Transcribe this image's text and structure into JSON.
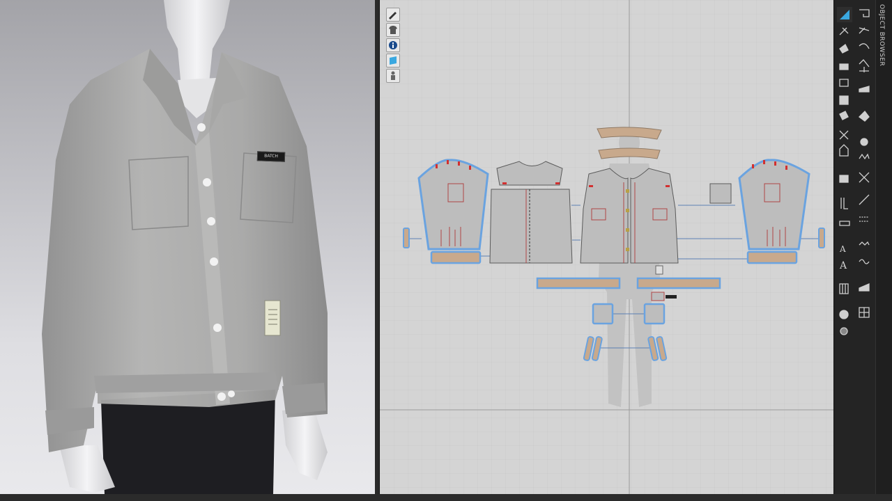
{
  "app": {
    "panels": {
      "object_browser_label": "OBJECT BROWSER"
    },
    "garment": {
      "name_tag_text": "BATCH"
    },
    "left_tools": [
      {
        "icon": "pencil-icon"
      },
      {
        "icon": "shirt-icon"
      },
      {
        "icon": "info-icon"
      },
      {
        "icon": "fabric-icon"
      },
      {
        "icon": "avatar-icon"
      }
    ],
    "right_tools_col1": [
      {
        "icon": "select-pattern-icon",
        "active": true
      },
      {
        "icon": "edit-pattern-icon"
      },
      {
        "icon": "transform-icon"
      },
      {
        "icon": "polygon-icon"
      },
      {
        "icon": "rectangle-icon"
      },
      {
        "icon": "internal-shape-icon"
      },
      {
        "icon": "fold-icon"
      },
      {
        "icon": "cut-icon"
      },
      {
        "icon": "sewing-icon"
      },
      {
        "icon": "segment-sew-icon"
      },
      {
        "icon": "measure-icon"
      },
      {
        "icon": "zipper-icon"
      },
      {
        "icon": "text-icon"
      },
      {
        "icon": "text-alt-icon"
      },
      {
        "icon": "grid-icon"
      },
      {
        "icon": "pin-icon"
      },
      {
        "icon": "avatar-small-icon"
      }
    ],
    "right_tools_col2": [
      {
        "icon": "undo-pattern-icon"
      },
      {
        "icon": "node-icon"
      },
      {
        "icon": "curve-icon"
      },
      {
        "icon": "arc-icon"
      },
      {
        "icon": "seam-icon"
      },
      {
        "icon": "iron-icon"
      },
      {
        "icon": "trim-icon"
      },
      {
        "icon": "button-icon"
      },
      {
        "icon": "buttonhole-icon"
      },
      {
        "icon": "puckering-icon"
      },
      {
        "icon": "line-icon"
      },
      {
        "icon": "stitch-icon"
      },
      {
        "icon": "zigzag-icon"
      },
      {
        "icon": "wave-icon"
      },
      {
        "icon": "graphic-icon"
      },
      {
        "icon": "table-icon"
      }
    ],
    "colors": {
      "pattern_fill": "#bdbdbd",
      "trim_fill": "#c8a98c",
      "selection_outline": "#6aa3e0",
      "notch": "#d23030",
      "toolbar_bg": "#242424",
      "active_tool": "#3aa8e0"
    }
  }
}
